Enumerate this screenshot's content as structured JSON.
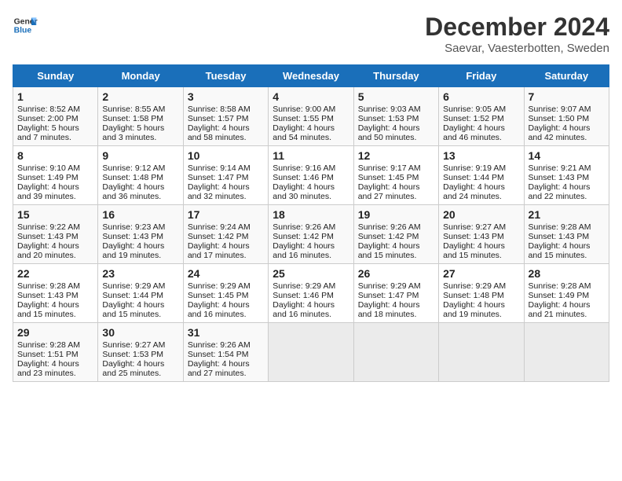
{
  "header": {
    "logo_line1": "General",
    "logo_line2": "Blue",
    "title": "December 2024",
    "subtitle": "Saevar, Vaesterbotten, Sweden"
  },
  "columns": [
    "Sunday",
    "Monday",
    "Tuesday",
    "Wednesday",
    "Thursday",
    "Friday",
    "Saturday"
  ],
  "weeks": [
    [
      {
        "day": "1",
        "sunrise": "Sunrise: 8:52 AM",
        "sunset": "Sunset: 2:00 PM",
        "daylight": "Daylight: 5 hours and 7 minutes."
      },
      {
        "day": "2",
        "sunrise": "Sunrise: 8:55 AM",
        "sunset": "Sunset: 1:58 PM",
        "daylight": "Daylight: 5 hours and 3 minutes."
      },
      {
        "day": "3",
        "sunrise": "Sunrise: 8:58 AM",
        "sunset": "Sunset: 1:57 PM",
        "daylight": "Daylight: 4 hours and 58 minutes."
      },
      {
        "day": "4",
        "sunrise": "Sunrise: 9:00 AM",
        "sunset": "Sunset: 1:55 PM",
        "daylight": "Daylight: 4 hours and 54 minutes."
      },
      {
        "day": "5",
        "sunrise": "Sunrise: 9:03 AM",
        "sunset": "Sunset: 1:53 PM",
        "daylight": "Daylight: 4 hours and 50 minutes."
      },
      {
        "day": "6",
        "sunrise": "Sunrise: 9:05 AM",
        "sunset": "Sunset: 1:52 PM",
        "daylight": "Daylight: 4 hours and 46 minutes."
      },
      {
        "day": "7",
        "sunrise": "Sunrise: 9:07 AM",
        "sunset": "Sunset: 1:50 PM",
        "daylight": "Daylight: 4 hours and 42 minutes."
      }
    ],
    [
      {
        "day": "8",
        "sunrise": "Sunrise: 9:10 AM",
        "sunset": "Sunset: 1:49 PM",
        "daylight": "Daylight: 4 hours and 39 minutes."
      },
      {
        "day": "9",
        "sunrise": "Sunrise: 9:12 AM",
        "sunset": "Sunset: 1:48 PM",
        "daylight": "Daylight: 4 hours and 36 minutes."
      },
      {
        "day": "10",
        "sunrise": "Sunrise: 9:14 AM",
        "sunset": "Sunset: 1:47 PM",
        "daylight": "Daylight: 4 hours and 32 minutes."
      },
      {
        "day": "11",
        "sunrise": "Sunrise: 9:16 AM",
        "sunset": "Sunset: 1:46 PM",
        "daylight": "Daylight: 4 hours and 30 minutes."
      },
      {
        "day": "12",
        "sunrise": "Sunrise: 9:17 AM",
        "sunset": "Sunset: 1:45 PM",
        "daylight": "Daylight: 4 hours and 27 minutes."
      },
      {
        "day": "13",
        "sunrise": "Sunrise: 9:19 AM",
        "sunset": "Sunset: 1:44 PM",
        "daylight": "Daylight: 4 hours and 24 minutes."
      },
      {
        "day": "14",
        "sunrise": "Sunrise: 9:21 AM",
        "sunset": "Sunset: 1:43 PM",
        "daylight": "Daylight: 4 hours and 22 minutes."
      }
    ],
    [
      {
        "day": "15",
        "sunrise": "Sunrise: 9:22 AM",
        "sunset": "Sunset: 1:43 PM",
        "daylight": "Daylight: 4 hours and 20 minutes."
      },
      {
        "day": "16",
        "sunrise": "Sunrise: 9:23 AM",
        "sunset": "Sunset: 1:43 PM",
        "daylight": "Daylight: 4 hours and 19 minutes."
      },
      {
        "day": "17",
        "sunrise": "Sunrise: 9:24 AM",
        "sunset": "Sunset: 1:42 PM",
        "daylight": "Daylight: 4 hours and 17 minutes."
      },
      {
        "day": "18",
        "sunrise": "Sunrise: 9:26 AM",
        "sunset": "Sunset: 1:42 PM",
        "daylight": "Daylight: 4 hours and 16 minutes."
      },
      {
        "day": "19",
        "sunrise": "Sunrise: 9:26 AM",
        "sunset": "Sunset: 1:42 PM",
        "daylight": "Daylight: 4 hours and 15 minutes."
      },
      {
        "day": "20",
        "sunrise": "Sunrise: 9:27 AM",
        "sunset": "Sunset: 1:43 PM",
        "daylight": "Daylight: 4 hours and 15 minutes."
      },
      {
        "day": "21",
        "sunrise": "Sunrise: 9:28 AM",
        "sunset": "Sunset: 1:43 PM",
        "daylight": "Daylight: 4 hours and 15 minutes."
      }
    ],
    [
      {
        "day": "22",
        "sunrise": "Sunrise: 9:28 AM",
        "sunset": "Sunset: 1:43 PM",
        "daylight": "Daylight: 4 hours and 15 minutes."
      },
      {
        "day": "23",
        "sunrise": "Sunrise: 9:29 AM",
        "sunset": "Sunset: 1:44 PM",
        "daylight": "Daylight: 4 hours and 15 minutes."
      },
      {
        "day": "24",
        "sunrise": "Sunrise: 9:29 AM",
        "sunset": "Sunset: 1:45 PM",
        "daylight": "Daylight: 4 hours and 16 minutes."
      },
      {
        "day": "25",
        "sunrise": "Sunrise: 9:29 AM",
        "sunset": "Sunset: 1:46 PM",
        "daylight": "Daylight: 4 hours and 16 minutes."
      },
      {
        "day": "26",
        "sunrise": "Sunrise: 9:29 AM",
        "sunset": "Sunset: 1:47 PM",
        "daylight": "Daylight: 4 hours and 18 minutes."
      },
      {
        "day": "27",
        "sunrise": "Sunrise: 9:29 AM",
        "sunset": "Sunset: 1:48 PM",
        "daylight": "Daylight: 4 hours and 19 minutes."
      },
      {
        "day": "28",
        "sunrise": "Sunrise: 9:28 AM",
        "sunset": "Sunset: 1:49 PM",
        "daylight": "Daylight: 4 hours and 21 minutes."
      }
    ],
    [
      {
        "day": "29",
        "sunrise": "Sunrise: 9:28 AM",
        "sunset": "Sunset: 1:51 PM",
        "daylight": "Daylight: 4 hours and 23 minutes."
      },
      {
        "day": "30",
        "sunrise": "Sunrise: 9:27 AM",
        "sunset": "Sunset: 1:53 PM",
        "daylight": "Daylight: 4 hours and 25 minutes."
      },
      {
        "day": "31",
        "sunrise": "Sunrise: 9:26 AM",
        "sunset": "Sunset: 1:54 PM",
        "daylight": "Daylight: 4 hours and 27 minutes."
      },
      null,
      null,
      null,
      null
    ]
  ]
}
